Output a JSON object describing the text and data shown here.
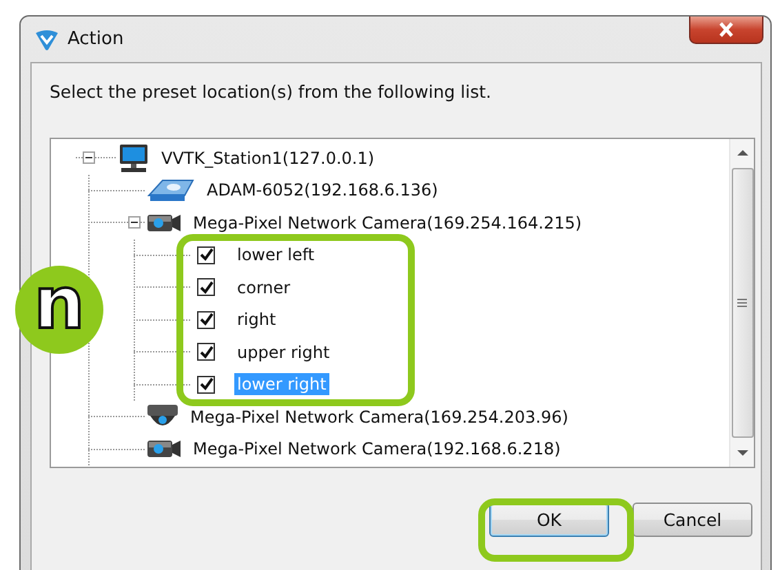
{
  "window": {
    "title": "Action"
  },
  "instruction": "Select the preset location(s) from the following list.",
  "tree": [
    {
      "kind": "computer",
      "label": "VVTK_Station1(127.0.0.1)",
      "expanded": true,
      "children": [
        {
          "kind": "module",
          "label": "ADAM-6052(192.168.6.136)"
        },
        {
          "kind": "camera",
          "label": "Mega-Pixel Network Camera(169.254.164.215)",
          "expanded": true,
          "children": [
            {
              "kind": "preset",
              "label": "lower left",
              "checked": true,
              "selected": false
            },
            {
              "kind": "preset",
              "label": "corner",
              "checked": true,
              "selected": false
            },
            {
              "kind": "preset",
              "label": "right",
              "checked": true,
              "selected": false
            },
            {
              "kind": "preset",
              "label": "upper right",
              "checked": true,
              "selected": false
            },
            {
              "kind": "preset",
              "label": "lower right",
              "checked": true,
              "selected": true
            }
          ]
        },
        {
          "kind": "dome",
          "label": "Mega-Pixel Network Camera(169.254.203.96)"
        },
        {
          "kind": "camera",
          "label": "Mega-Pixel Network Camera(192.168.6.218)"
        }
      ]
    }
  ],
  "buttons": [
    {
      "label": "OK",
      "highlighted": true
    },
    {
      "label": "Cancel",
      "highlighted": false
    }
  ],
  "callout": {
    "letter": "n"
  }
}
